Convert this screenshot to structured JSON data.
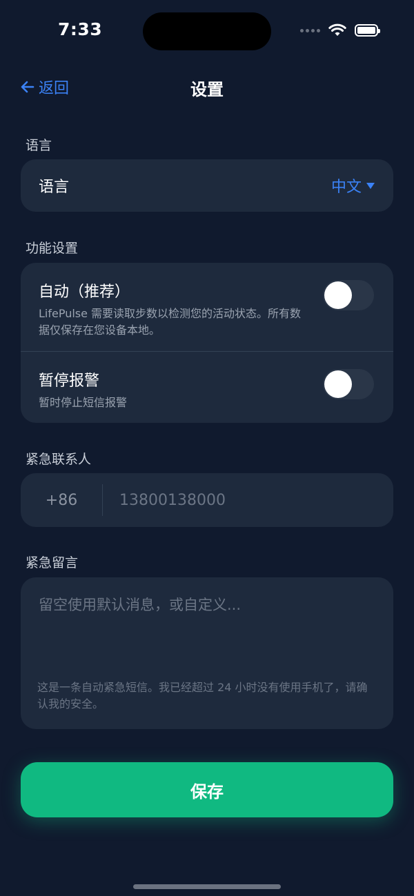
{
  "status_bar": {
    "time": "7:33",
    "icons": [
      "signal-icon",
      "wifi-icon",
      "battery-icon"
    ]
  },
  "nav": {
    "back_label": "返回",
    "title": "设置",
    "back_icon": "arrow-left-icon"
  },
  "sections": {
    "language": "语言",
    "function": "功能设置",
    "contact": "紧急联系人",
    "message": "紧急留言"
  },
  "language_row": {
    "label": "语言",
    "value": "中文",
    "dropdown_icon": "caret-down-icon"
  },
  "function_settings": [
    {
      "title": "自动（推荐）",
      "description": "LifePulse 需要读取步数以检测您的活动状态。所有数据仅保存在您设备本地。",
      "enabled": false
    },
    {
      "title": "暂停报警",
      "description": "暂时停止短信报警",
      "enabled": false
    }
  ],
  "contact": {
    "country_code": "+86",
    "phone_placeholder": "13800138000"
  },
  "message": {
    "placeholder": "留空使用默认消息，或自定义...",
    "hint": "这是一条自动紧急短信。我已经超过 24 小时没有使用手机了，请确认我的安全。"
  },
  "save_label": "保存",
  "colors": {
    "background": "#101a2e",
    "card": "#1e2a3d",
    "accent": "#3b82f6",
    "save": "#10b981"
  }
}
